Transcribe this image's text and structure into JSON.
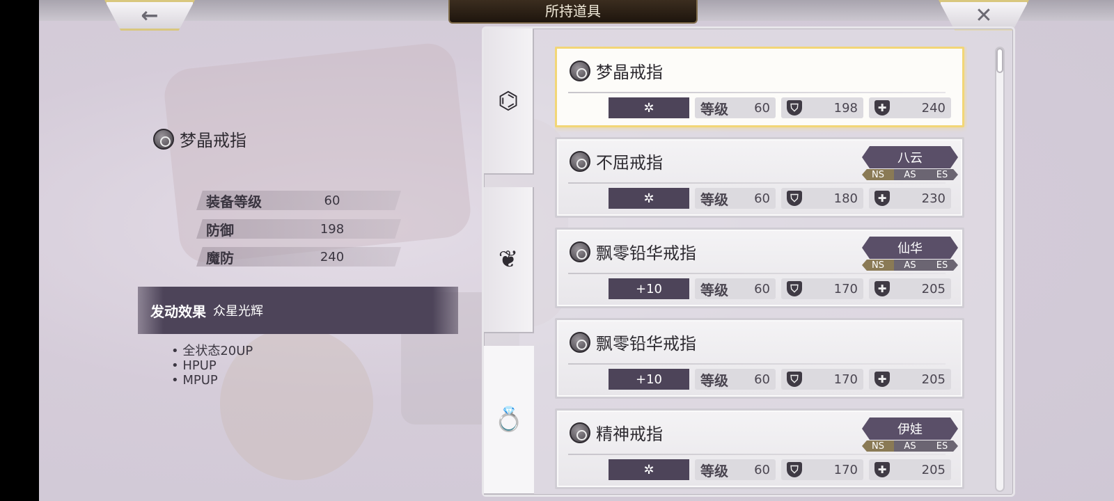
{
  "header": {
    "title": "所持道具",
    "back_icon": "←",
    "close_icon": "✕"
  },
  "detail": {
    "name": "梦晶戒指",
    "stats": [
      {
        "label": "装备等级",
        "value": "60"
      },
      {
        "label": "防御",
        "value": "198"
      },
      {
        "label": "魔防",
        "value": "240"
      }
    ],
    "effect_title": "发动效果",
    "effect_name": "众星光辉",
    "effects": [
      "全状态20UP",
      "HPUP",
      "MPUP"
    ]
  },
  "tabs": {
    "bracelet_icon": "⌬",
    "necklace_icon": "❦",
    "ring_icon": "💍"
  },
  "items": [
    {
      "name": "梦晶戒指",
      "refine": "✲",
      "level_label": "等级",
      "level": "60",
      "def": "198",
      "mdef": "240",
      "owner": "",
      "selected": true
    },
    {
      "name": "不屈戒指",
      "refine": "✲",
      "level_label": "等级",
      "level": "60",
      "def": "180",
      "mdef": "230",
      "owner": "八云",
      "flags": [
        "NS",
        "AS",
        "ES"
      ]
    },
    {
      "name": "飘零铅华戒指",
      "refine": "+10",
      "level_label": "等级",
      "level": "60",
      "def": "170",
      "mdef": "205",
      "owner": "仙华",
      "flags": [
        "NS",
        "AS",
        "ES"
      ]
    },
    {
      "name": "飘零铅华戒指",
      "refine": "+10",
      "level_label": "等级",
      "level": "60",
      "def": "170",
      "mdef": "205",
      "owner": ""
    },
    {
      "name": "精神戒指",
      "refine": "✲",
      "level_label": "等级",
      "level": "60",
      "def": "170",
      "mdef": "205",
      "owner": "伊娃",
      "flags": [
        "NS",
        "AS",
        "ES"
      ]
    }
  ],
  "icons": {
    "def": "⛉",
    "mdef": "✚"
  }
}
